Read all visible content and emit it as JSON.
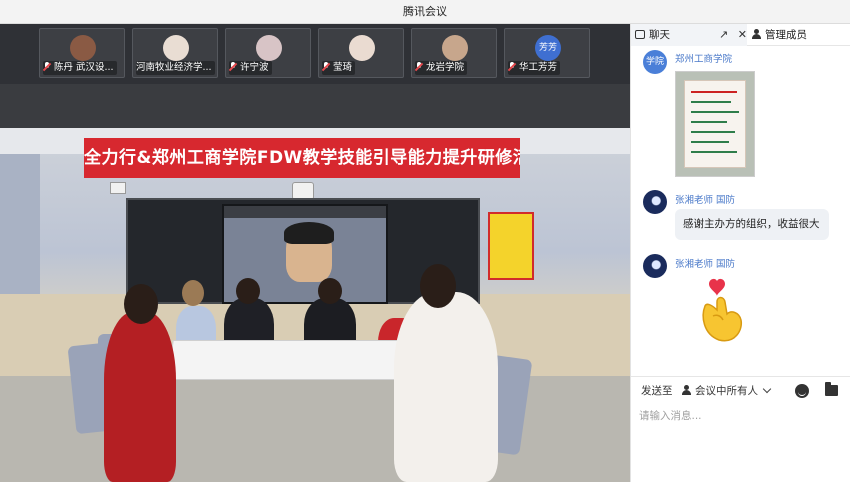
{
  "window": {
    "title": "腾讯会议"
  },
  "participants": [
    {
      "name": "陈丹 武汉设...",
      "muted": true,
      "avatar_color": "#8a5a44"
    },
    {
      "name": "河南牧业经济学...",
      "muted": false,
      "avatar_color": "#d9c7b9"
    },
    {
      "name": "许宁波",
      "muted": true,
      "avatar_color": "#c9b6b1"
    },
    {
      "name": "莹琦",
      "muted": true,
      "avatar_color": "#e3d0c6"
    },
    {
      "name": "龙岩学院",
      "muted": true,
      "avatar_color": "#c7a68c"
    },
    {
      "name": "华工芳芳",
      "muted": true,
      "avatar_text": "芳芳",
      "avatar_color": "#3f6fd1"
    }
  ],
  "video": {
    "banner_text": "全力行&郑州工商学院FDW教学技能引导能力提升研修活动"
  },
  "panel": {
    "tabs": {
      "chat": "聊天",
      "members": "管理成员"
    },
    "messages": [
      {
        "sender": "郑州工商学院",
        "avatar_text": "学院",
        "type": "image"
      },
      {
        "sender": "张湘老师 国防",
        "type": "text",
        "text": "感谢主办方的组织，收益很大"
      },
      {
        "sender": "张湘老师 国防",
        "type": "emoji",
        "emoji": "heart-hand"
      }
    ],
    "send": {
      "label": "发送至",
      "target": "会议中所有人",
      "placeholder": "请输入消息..."
    }
  },
  "colors": {
    "banner": "#d7282f",
    "link_blue": "#4a79c9",
    "accent": "#3f6fd1"
  }
}
